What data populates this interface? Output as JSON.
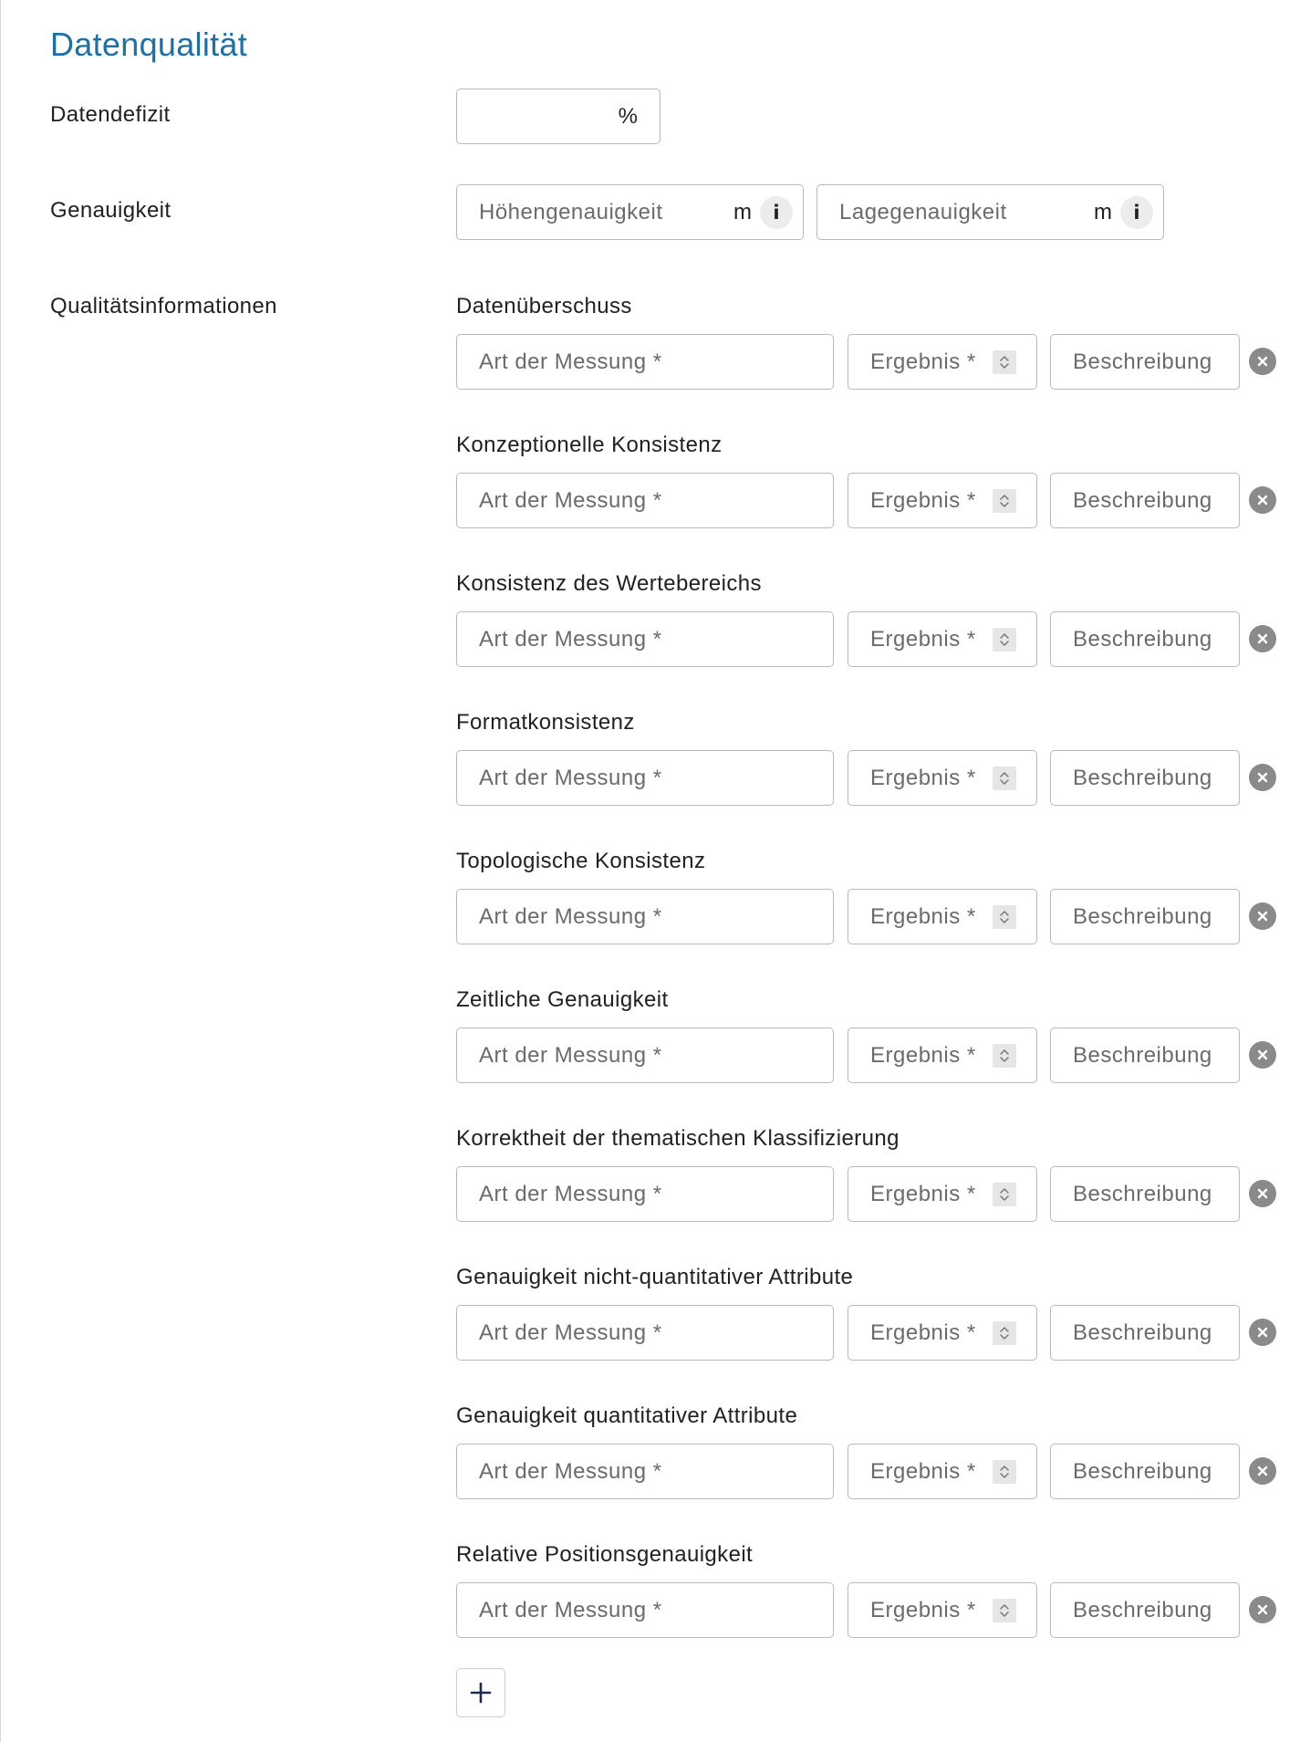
{
  "section": {
    "title": "Datenqualität"
  },
  "datendefizit": {
    "label": "Datendefizit",
    "value": "",
    "unit": "%"
  },
  "genauigkeit": {
    "label": "Genauigkeit",
    "hoehe": {
      "placeholder": "Höhengenauigkeit",
      "unit": "m",
      "info_icon": "info-icon"
    },
    "lage": {
      "placeholder": "Lagegenauigkeit",
      "unit": "m",
      "info_icon": "info-icon"
    }
  },
  "quality": {
    "label": "Qualitätsinformationen",
    "field_placeholders": {
      "art": "Art der Messung *",
      "ergebnis": "Ergebnis *",
      "beschreibung": "Beschreibung"
    },
    "groups": [
      {
        "title": "Datenüberschuss"
      },
      {
        "title": "Konzeptionelle Konsistenz"
      },
      {
        "title": "Konsistenz des Wertebereichs"
      },
      {
        "title": "Formatkonsistenz"
      },
      {
        "title": "Topologische Konsistenz"
      },
      {
        "title": "Zeitliche Genauigkeit"
      },
      {
        "title": "Korrektheit der thematischen Klassifizierung"
      },
      {
        "title": "Genauigkeit nicht-quantitativer Attribute"
      },
      {
        "title": "Genauigkeit quantitativer Attribute"
      },
      {
        "title": "Relative Positionsgenauigkeit"
      }
    ],
    "add_icon": "plus-icon",
    "remove_icon": "close-icon"
  },
  "colors": {
    "title": "#1f6fa3",
    "border": "#b9b9b9",
    "placeholder": "#6b6b6b",
    "remove_button": "#8a8a8a"
  }
}
